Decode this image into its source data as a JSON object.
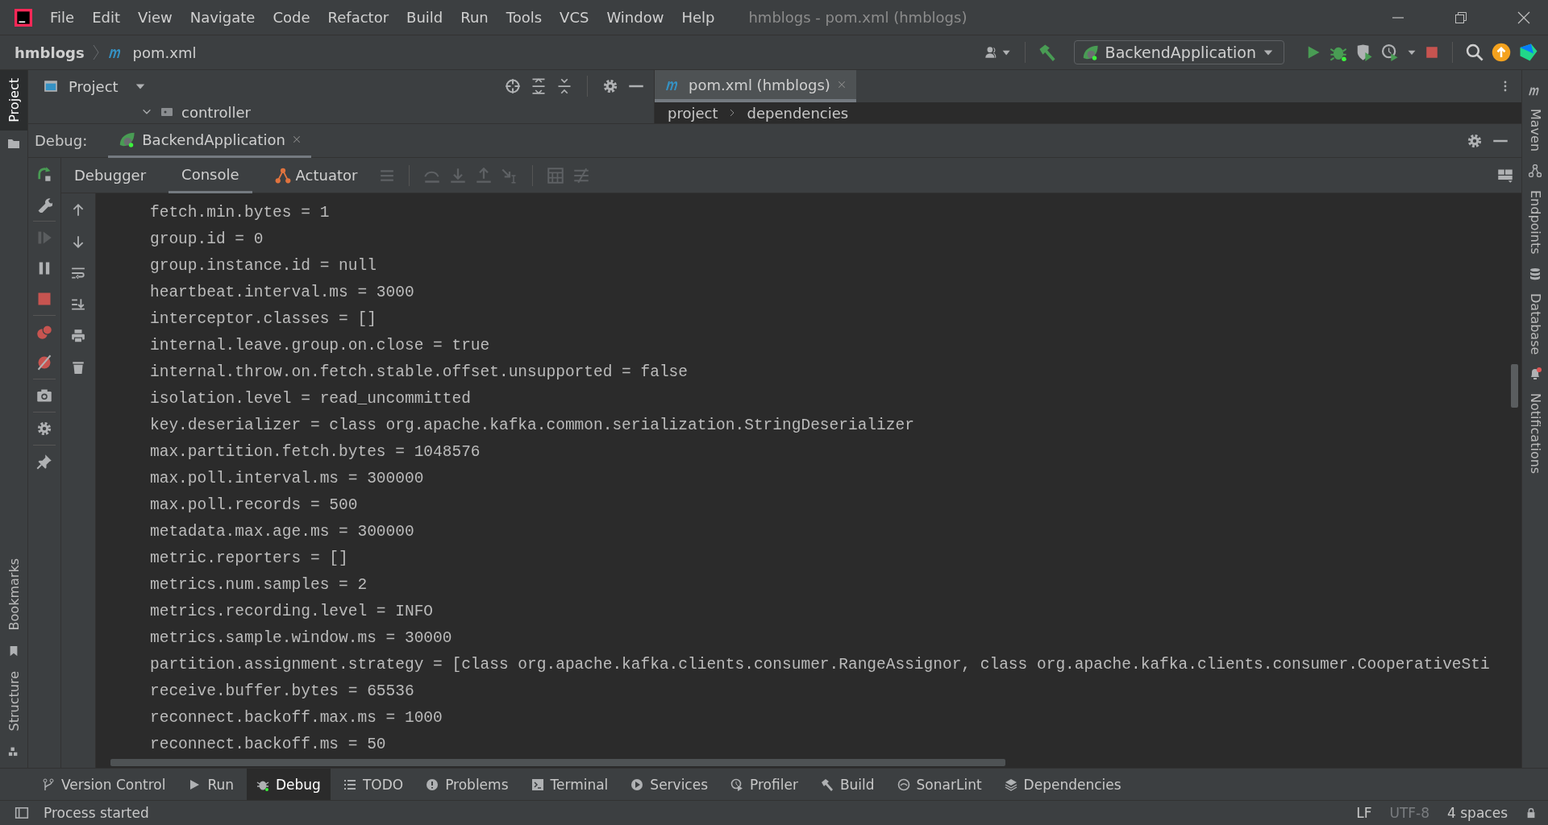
{
  "menu": [
    "File",
    "Edit",
    "View",
    "Navigate",
    "Code",
    "Refactor",
    "Build",
    "Run",
    "Tools",
    "VCS",
    "Window",
    "Help"
  ],
  "window_title": "hmblogs - pom.xml (hmblogs)",
  "breadcrumb": [
    "hmblogs",
    "pom.xml"
  ],
  "run_config": "BackendApplication",
  "project_panel": {
    "title": "Project",
    "tree": [
      {
        "label": "controller",
        "expanded": true
      }
    ]
  },
  "editor_tab": {
    "label": "pom.xml (hmblogs)",
    "selected": true
  },
  "editor_breadcrumb": [
    "project",
    "dependencies"
  ],
  "debug": {
    "label": "Debug:",
    "session_tab": "BackendApplication"
  },
  "debug_tabs": [
    {
      "label": "Debugger",
      "selected": false
    },
    {
      "label": "Console",
      "selected": true
    },
    {
      "label": "Actuator",
      "selected": false
    }
  ],
  "console_lines": [
    "fetch.min.bytes = 1",
    "group.id = 0",
    "group.instance.id = null",
    "heartbeat.interval.ms = 3000",
    "interceptor.classes = []",
    "internal.leave.group.on.close = true",
    "internal.throw.on.fetch.stable.offset.unsupported = false",
    "isolation.level = read_uncommitted",
    "key.deserializer = class org.apache.kafka.common.serialization.StringDeserializer",
    "max.partition.fetch.bytes = 1048576",
    "max.poll.interval.ms = 300000",
    "max.poll.records = 500",
    "metadata.max.age.ms = 300000",
    "metric.reporters = []",
    "metrics.num.samples = 2",
    "metrics.recording.level = INFO",
    "metrics.sample.window.ms = 30000",
    "partition.assignment.strategy = [class org.apache.kafka.clients.consumer.RangeAssignor, class org.apache.kafka.clients.consumer.CooperativeSti",
    "receive.buffer.bytes = 65536",
    "reconnect.backoff.max.ms = 1000",
    "reconnect.backoff.ms = 50"
  ],
  "left_stripe_top": [
    {
      "label": "Project",
      "selected": true
    }
  ],
  "left_stripe_bottom": [
    {
      "label": "Bookmarks",
      "selected": false
    },
    {
      "label": "Structure",
      "selected": false
    }
  ],
  "right_stripe": [
    "Maven",
    "Endpoints",
    "Database",
    "Notifications"
  ],
  "tool_windows": [
    {
      "label": "Version Control",
      "selected": false
    },
    {
      "label": "Run",
      "selected": false
    },
    {
      "label": "Debug",
      "selected": true
    },
    {
      "label": "TODO",
      "selected": false
    },
    {
      "label": "Problems",
      "selected": false
    },
    {
      "label": "Terminal",
      "selected": false
    },
    {
      "label": "Services",
      "selected": false
    },
    {
      "label": "Profiler",
      "selected": false
    },
    {
      "label": "Build",
      "selected": false
    },
    {
      "label": "SonarLint",
      "selected": false
    },
    {
      "label": "Dependencies",
      "selected": false
    }
  ],
  "status": {
    "message": "Process started",
    "line_separator": "LF",
    "encoding": "UTF-8",
    "indent": "4 spaces"
  }
}
